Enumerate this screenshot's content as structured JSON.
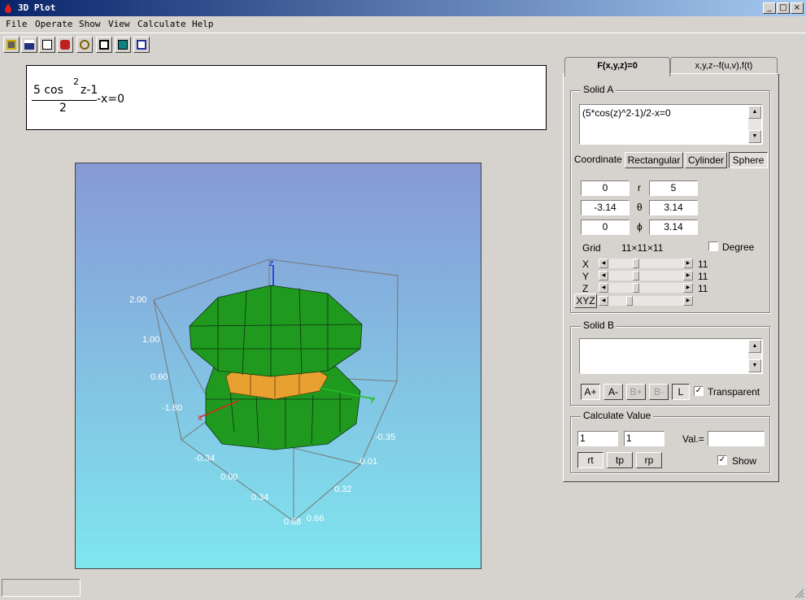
{
  "window": {
    "title": "3D Plot",
    "min": "_",
    "max": "□",
    "close": "×"
  },
  "menu": [
    "File",
    "Operate",
    "Show",
    "View",
    "Calculate",
    "Help"
  ],
  "toolbar_icons": [
    "print-icon",
    "save-icon",
    "print-preview-icon",
    "paint-icon",
    "rotate-icon",
    "export-icon",
    "book-icon",
    "window-icon"
  ],
  "formula": {
    "numerator_text": "5  cos",
    "exp": "2",
    "after_exp": "z-1",
    "denominator": "2",
    "tail": "-x=0"
  },
  "plot": {
    "axes": {
      "x": "x",
      "y": "y",
      "z": "z"
    },
    "z_ticks": [
      "2.00",
      "1.00",
      "0.60",
      "-1.80"
    ],
    "x_ticks": [
      "-0.34",
      "0.00",
      "0.34",
      "0.68"
    ],
    "y_ticks": [
      "-0.35",
      "-0.01",
      "0.32",
      "0.66"
    ],
    "colors": {
      "solid": "#1f9a1f",
      "band": "#e8a030",
      "axis_x": "#e02020",
      "axis_y": "#20c020",
      "axis_z": "#2020d0"
    }
  },
  "tabs": [
    {
      "label": "F(x,y,z)=0"
    },
    {
      "label": "x,y,z--f(u,v),f(t)"
    }
  ],
  "solid_a": {
    "title": "Solid A",
    "expression": "(5*cos(z)^2-1)/2-x=0",
    "coordinate_label": "Coordinate",
    "coord_buttons": [
      "Rectangular",
      "Cylinder",
      "Sphere"
    ],
    "ranges": [
      {
        "min": "0",
        "sym": "r",
        "max": "5"
      },
      {
        "min": "-3.14",
        "sym": "θ",
        "max": "3.14"
      },
      {
        "min": "0",
        "sym": "ϕ",
        "max": "3.14"
      }
    ],
    "grid_label": "Grid",
    "grid_value": "11×11×11",
    "degree_label": "Degree",
    "sliders": [
      {
        "label": "X",
        "value": "11"
      },
      {
        "label": "Y",
        "value": "11"
      },
      {
        "label": "Z",
        "value": "11"
      }
    ],
    "xyz_button": "XYZ"
  },
  "solid_b": {
    "title": "Solid B",
    "expression": "",
    "buttons": [
      "A+",
      "A-",
      "B+",
      "B-",
      "L"
    ],
    "transparent_label": "Transparent",
    "transparent_checked": "✓"
  },
  "calc": {
    "title": "Calculate Value",
    "input1": "1",
    "input2": "1",
    "val_label": "Val.=",
    "val": "",
    "buttons": [
      "rt",
      "tp",
      "rp"
    ],
    "show_label": "Show",
    "show_checked": "✓"
  }
}
